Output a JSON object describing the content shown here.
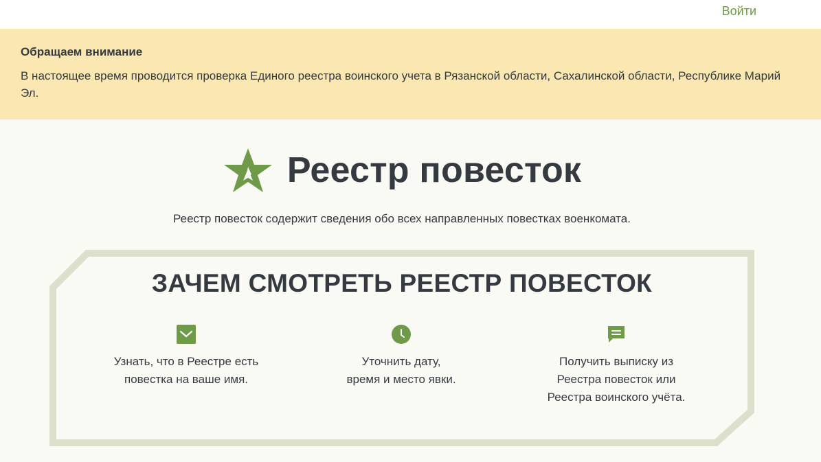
{
  "header": {
    "login_label": "Войти"
  },
  "notice": {
    "title": "Обращаем внимание",
    "text": "В настоящее время проводится проверка Единого реестра воинского учета в Рязанской области, Сахалинской области, Республике Марий Эл."
  },
  "hero": {
    "title": "Реестр повесток",
    "subtitle": "Реестр повесток содержит сведения обо всех направленных повестках военкомата."
  },
  "why": {
    "title": "ЗАЧЕМ СМОТРЕТЬ РЕЕСТР ПОВЕСТОК",
    "features": [
      {
        "icon": "envelope-icon",
        "text": "Узнать, что в Реестре есть\nповестка на ваше имя."
      },
      {
        "icon": "clock-icon",
        "text": "Уточнить дату,\nвремя и место явки."
      },
      {
        "icon": "message-icon",
        "text": "Получить выписку из\nРеестра повесток или\nРеестра воинского учёта."
      }
    ]
  },
  "colors": {
    "accent_green": "#6f9a4a",
    "notice_bg": "#fbe7b2",
    "frame": "#dcdfcc",
    "page_bg": "#fafaf5",
    "text": "#343a40"
  }
}
